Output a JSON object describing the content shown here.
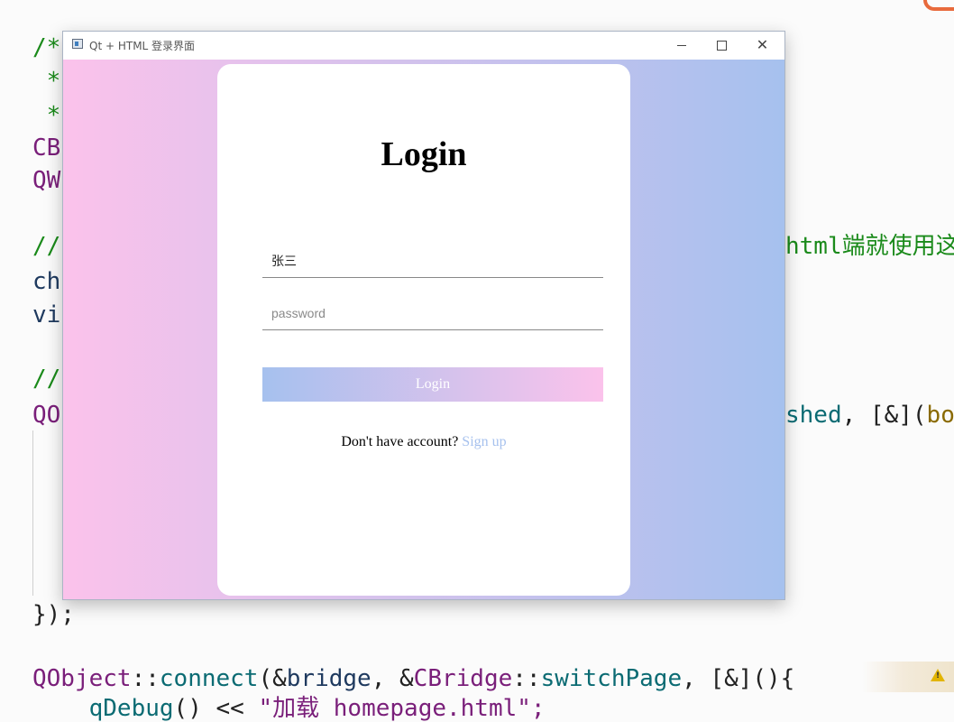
{
  "editor": {
    "lines": {
      "l1": "/*",
      "l2": " *",
      "l3": " *",
      "l4": "CB",
      "l5": "QW",
      "l6": "//",
      "l7": "ch",
      "l8": "vi",
      "l9": "//",
      "l10": "QO",
      "l11": "});",
      "l12_ns": "QObject",
      "l12_sep": "::",
      "l12_fn": "connect",
      "l12_a": "(&",
      "l12_b": "bridge",
      "l12_c": ", &",
      "l12_cls": "CBridge",
      "l12_sep2": "::",
      "l12_fn2": "switchPage",
      "l12_d": ", [&](){",
      "l13_pre": "    ",
      "l13_fn": "qDebug",
      "l13_a": "() << ",
      "l13_str": "\"加载 homepage.html\";"
    },
    "right_fragment_1": "html端就使用这",
    "right_fragment_2_fn": "shed",
    "right_fragment_2_rest": ", [&](",
    "right_fragment_2_kw": "bo"
  },
  "window": {
    "title": "Qt + HTML 登录界面",
    "close_glyph": "✕"
  },
  "login": {
    "title": "Login",
    "username_value": "张三",
    "password_placeholder": "password",
    "button_label": "Login",
    "no_account_text": "Don't have account? ",
    "signup_label": "Sign up"
  },
  "theme": {
    "gradient_start": "#fbc2eb",
    "gradient_end": "#a6c1ee"
  }
}
